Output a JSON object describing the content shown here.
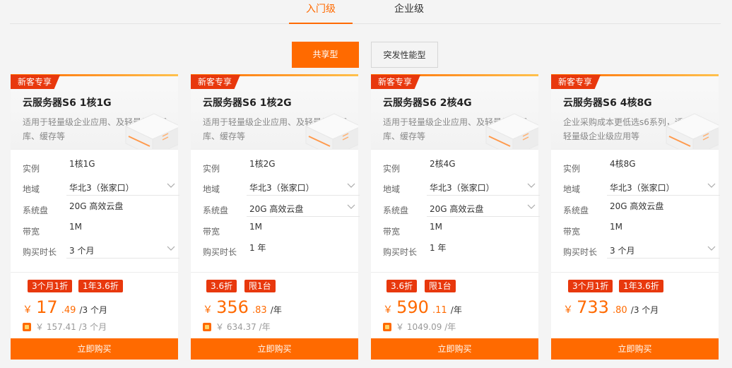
{
  "tabs": {
    "entry": "入门级",
    "enterprise": "企业级"
  },
  "subtabs": {
    "shared": "共享型",
    "burst": "突发性能型"
  },
  "labels": {
    "instance": "实例",
    "region": "地域",
    "disk": "系统盘",
    "bandwidth": "带宽",
    "duration": "购买时长",
    "buy": "立即购买"
  },
  "colors": {
    "accent": "#ff6a00",
    "badge": "#e8380d"
  },
  "cards": [
    {
      "badge": "新客专享",
      "title": "云服务器S6 1核1G",
      "desc": "适用于轻量级企业应用、及轻量级数据库、缓存等",
      "instance": "1核1G",
      "region": "华北3（张家口）",
      "disk": "20G 高效云盘",
      "bandwidth": "1M",
      "duration": "3 个月",
      "promo1": "3个月1折",
      "promo2": "1年3.6折",
      "currency": "￥",
      "price_int": "17",
      "price_dec": ".49",
      "price_unit": "/3 个月",
      "orig": "￥ 157.41 /3 个月"
    },
    {
      "badge": "新客专享",
      "title": "云服务器S6 1核2G",
      "desc": "适用于轻量级企业应用、及轻量级数据库、缓存等",
      "instance": "1核2G",
      "region": "华北3（张家口）",
      "disk": "20G 高效云盘",
      "bandwidth": "1M",
      "duration": "1 年",
      "promo1": "3.6折",
      "promo2": "限1台",
      "currency": "￥",
      "price_int": "356",
      "price_dec": ".83",
      "price_unit": "/年",
      "orig": "￥ 634.37 /年"
    },
    {
      "badge": "新客专享",
      "title": "云服务器S6 2核4G",
      "desc": "适用于轻量级企业应用、及轻量级数据库、缓存等",
      "instance": "2核4G",
      "region": "华北3（张家口）",
      "disk": "20G 高效云盘",
      "bandwidth": "1M",
      "duration": "1 年",
      "promo1": "3.6折",
      "promo2": "限1台",
      "currency": "￥",
      "price_int": "590",
      "price_dec": ".11",
      "price_unit": "/年",
      "orig": "￥ 1049.09 /年"
    },
    {
      "badge": "新客专享",
      "title": "云服务器S6 4核8G",
      "desc": "企业采购成本更低选s6系列，适用于轻量级企业级应用等",
      "instance": "4核8G",
      "region": "华北3（张家口）",
      "disk": "20G 高效云盘",
      "bandwidth": "1M",
      "duration": "3 个月",
      "promo1": "3个月1折",
      "promo2": "1年3.6折",
      "currency": "￥",
      "price_int": "733",
      "price_dec": ".80",
      "price_unit": "/3 个月",
      "orig": ""
    }
  ]
}
